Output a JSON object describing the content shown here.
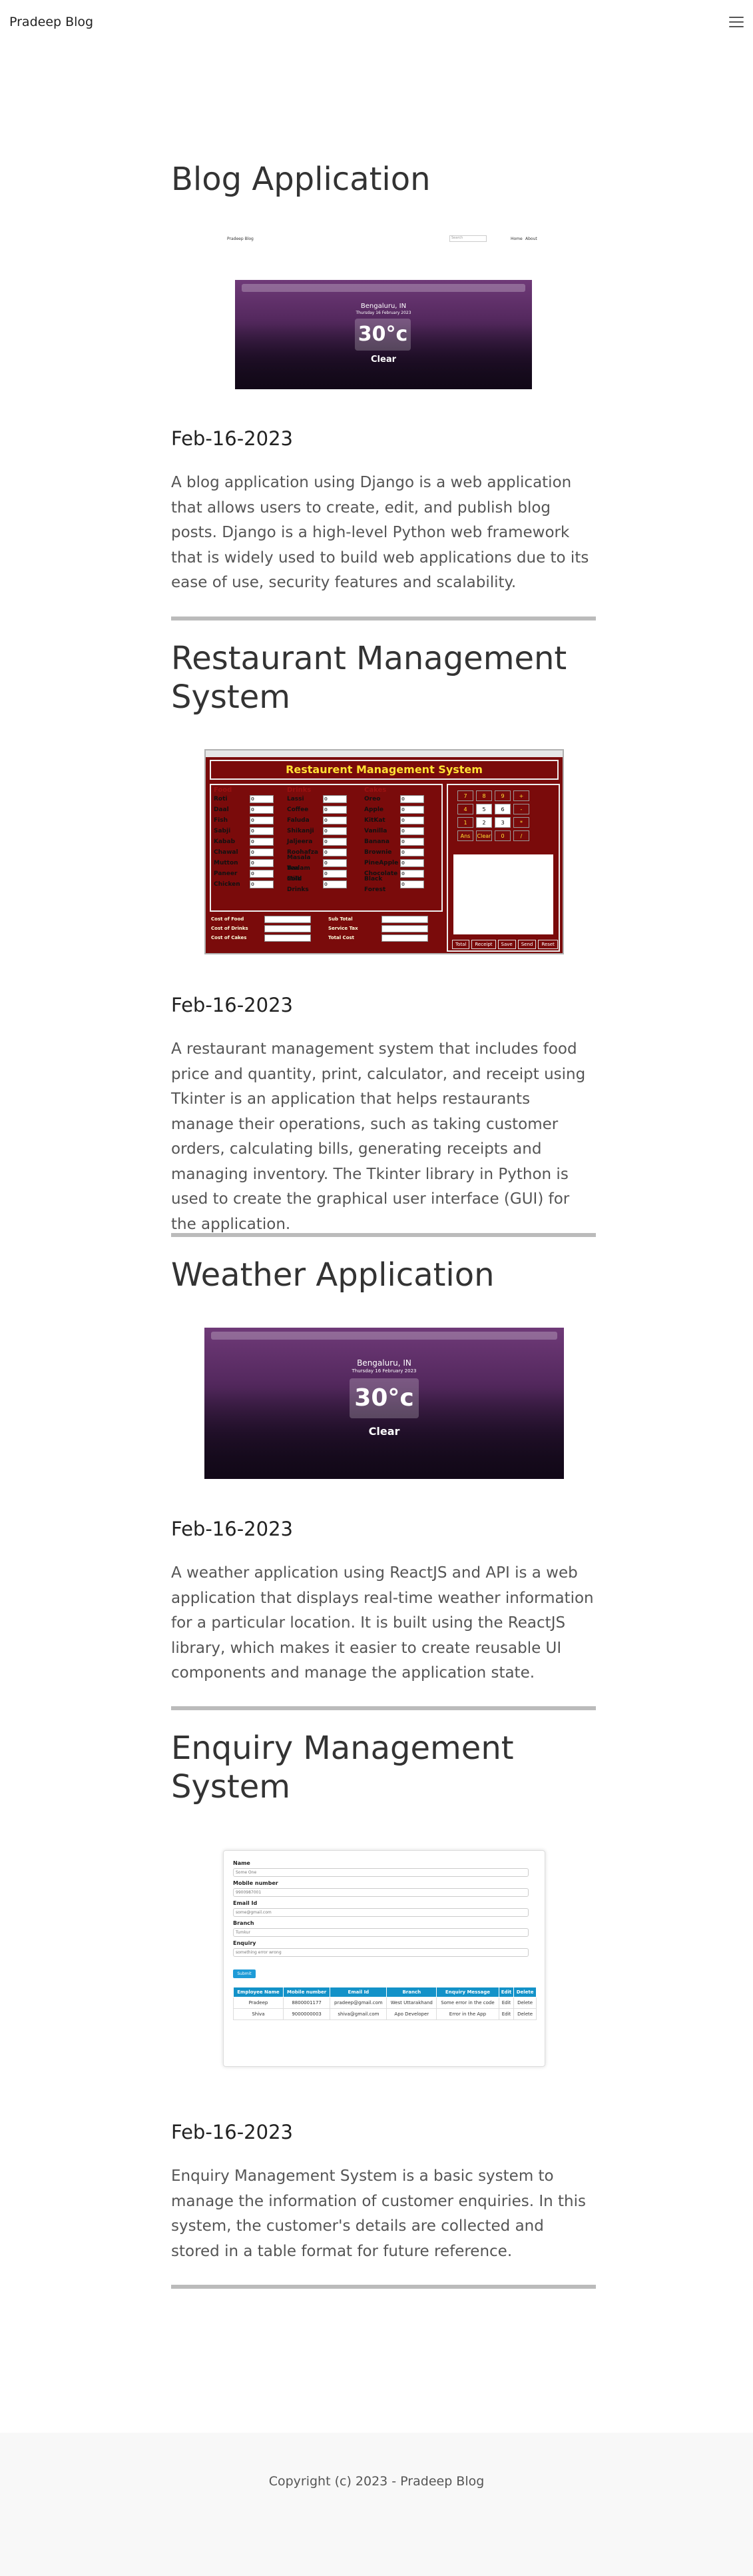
{
  "header": {
    "brand": "Pradeep Blog",
    "menu_icon": "hamburger-icon"
  },
  "posts": [
    {
      "title": "Blog Application",
      "date": "Feb-16-2023",
      "description": "A blog application using Django is a web application that allows users to create, edit, and publish blog posts. Django is a high-level Python web framework that is widely used to build web applications due to its ease of use, security features and scalability.",
      "screenshot": {
        "nav_brand": "Pradeep Blog",
        "nav_search": "Search",
        "nav_links": [
          "Home",
          "About"
        ],
        "city": "Bengaluru, IN",
        "date_line": "Thursday 16 February 2023",
        "temperature": "30°c",
        "condition": "Clear"
      }
    },
    {
      "title": "Restaurant Management System",
      "date": "Feb-16-2023",
      "description": "A restaurant management system that includes food price and quantity, print, calculator, and receipt using Tkinter is an application that helps restaurants manage their operations, such as taking customer orders, calculating bills, generating receipts and managing inventory. The Tkinter library in Python is used to create the graphical user interface (GUI) for the application.",
      "screenshot": {
        "app_title": "Restaurent Management System",
        "food_head": "Food",
        "food": [
          "Roti",
          "Daal",
          "Fish",
          "Sabji",
          "Kabab",
          "Chawal",
          "Mutton",
          "Paneer",
          "Chicken"
        ],
        "drinks_head": "Drinks",
        "drinks": [
          "Lassi",
          "Coffee",
          "Faluda",
          "Shikanji",
          "Jaljeera",
          "Roohafza",
          "Masala Tea",
          "Badam Milk",
          "Cold Drinks"
        ],
        "cakes_head": "Cakes",
        "cakes": [
          "Oreo",
          "Apple",
          "KitKat",
          "Vanilla",
          "Banana",
          "Brownie",
          "PineApple",
          "Chocolate",
          "Black Forest"
        ],
        "field_zero": "0",
        "calc_keys": [
          "7",
          "8",
          "9",
          "+",
          "4",
          "5",
          "6",
          "-",
          "1",
          "2",
          "3",
          "*",
          "Ans",
          "Clear",
          "0",
          "/"
        ],
        "actions": [
          "Total",
          "Receipt",
          "Save",
          "Send",
          "Reset"
        ],
        "costs_left": [
          "Cost of Food",
          "Cost of Drinks",
          "Cost of Cakes"
        ],
        "costs_right": [
          "Sub Total",
          "Service Tax",
          "Total Cost"
        ]
      }
    },
    {
      "title": "Weather Application",
      "date": "Feb-16-2023",
      "description": "A weather application using ReactJS and API is a web application that displays real-time weather information for a particular location. It is built using the ReactJS library, which makes it easier to create reusable UI components and manage the application state.",
      "screenshot": {
        "city": "Bengaluru, IN",
        "date_line": "Thursday 16 February 2023",
        "temperature": "30°c",
        "condition": "Clear"
      }
    },
    {
      "title": "Enquiry Management System",
      "date": "Feb-16-2023",
      "description": "Enquiry Management System is a basic system to manage the information of customer enquiries. In this system, the customer's details are collected and stored in a table format for future reference.",
      "screenshot": {
        "fields": [
          {
            "label": "Name",
            "value": "Some One"
          },
          {
            "label": "Mobile number",
            "value": "9900987001"
          },
          {
            "label": "Email Id",
            "value": "some@gmail.com"
          },
          {
            "label": "Branch",
            "value": "Tumkur"
          },
          {
            "label": "Enquiry",
            "value": "something error wrong"
          }
        ],
        "submit": "Submit",
        "columns": [
          "Employee Name",
          "Mobile number",
          "Email Id",
          "Branch",
          "Enquiry Message",
          "Edit",
          "Delete"
        ],
        "rows": [
          [
            "Pradeep",
            "8800001177",
            "pradeep@gmail.com",
            "West Uttarakhand",
            "Some error in the code",
            "Edit",
            "Delete"
          ],
          [
            "Shiva",
            "9000000003",
            "shiva@gmail.com",
            "Apo Developer",
            "Error in the App",
            "Edit",
            "Delete"
          ]
        ]
      }
    }
  ],
  "footer": {
    "text": "Copyright (c) 2023 - Pradeep Blog"
  }
}
